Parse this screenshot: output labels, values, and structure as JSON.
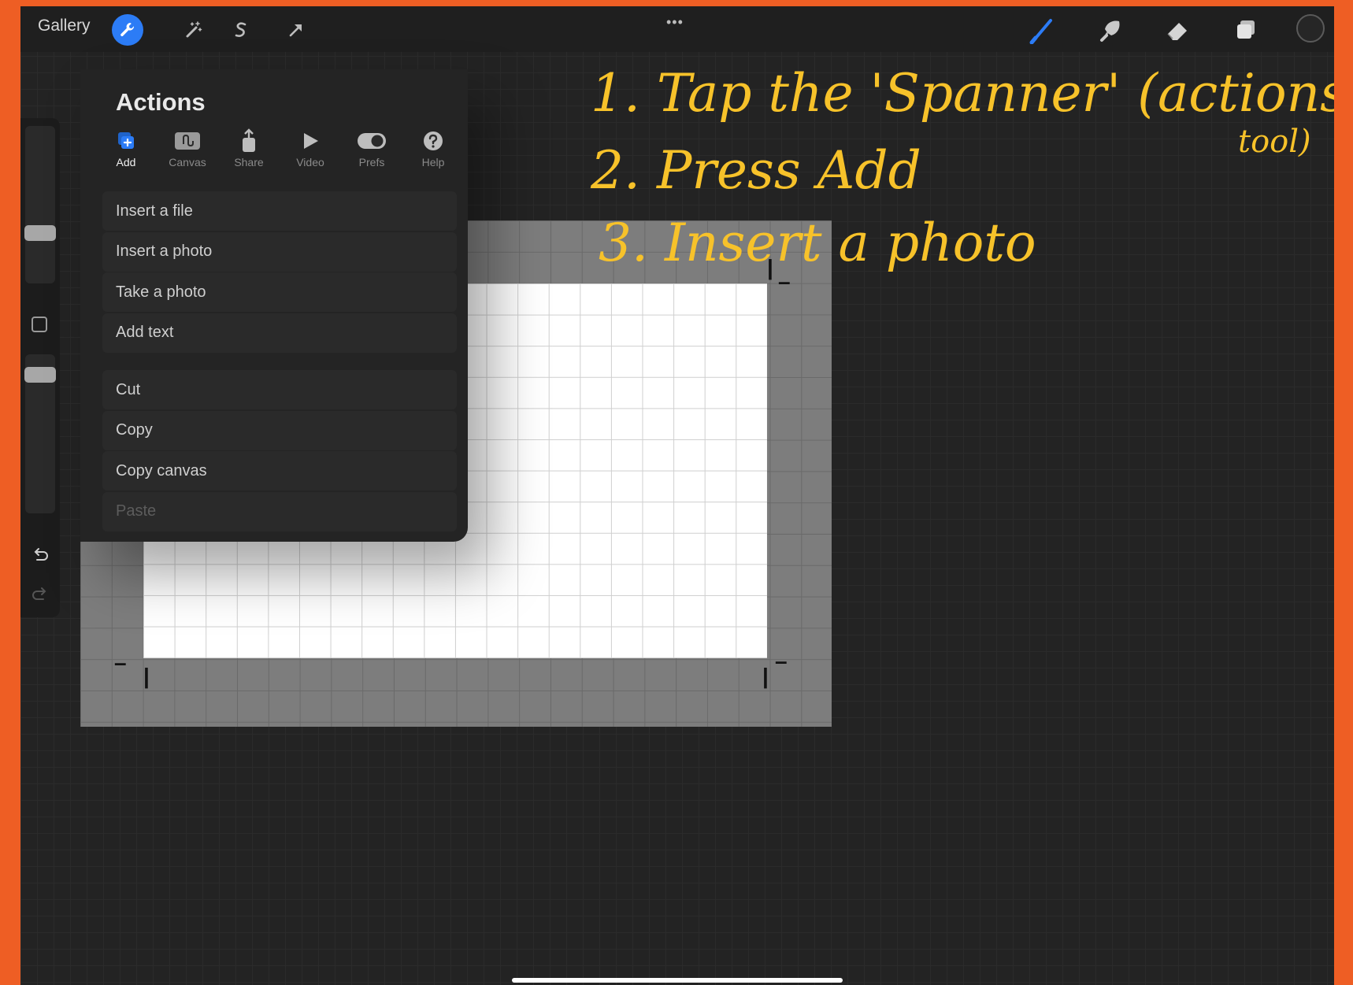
{
  "topbar": {
    "gallery_label": "Gallery",
    "more_dots": "•••",
    "tools_left": [
      "wrench-icon",
      "magic-wand-icon",
      "selection-s-icon",
      "move-arrow-icon"
    ],
    "tools_right": [
      "brush-icon",
      "smudge-icon",
      "eraser-icon",
      "layers-icon",
      "color-icon"
    ],
    "accent_color": "#2c7cf6"
  },
  "sidebar": {
    "icons": [
      "modify-square-icon",
      "undo-icon",
      "redo-icon"
    ]
  },
  "actions_panel": {
    "title": "Actions",
    "tabs": [
      {
        "label": "Add",
        "icon": "add-image-icon",
        "active": true
      },
      {
        "label": "Canvas",
        "icon": "canvas-icon",
        "active": false
      },
      {
        "label": "Share",
        "icon": "share-icon",
        "active": false
      },
      {
        "label": "Video",
        "icon": "play-icon",
        "active": false
      },
      {
        "label": "Prefs",
        "icon": "toggle-icon",
        "active": false
      },
      {
        "label": "Help",
        "icon": "help-icon",
        "active": false
      }
    ],
    "group1": [
      "Insert a file",
      "Insert a photo",
      "Take a photo",
      "Add text"
    ],
    "group2": [
      "Cut",
      "Copy",
      "Copy canvas",
      "Paste"
    ]
  },
  "annotations": {
    "line1": "1. Tap the 'Spanner' (actions",
    "line1_tail": "tool)",
    "line2": "2. Press Add",
    "line3": "3. Insert a photo",
    "color": "#f7c22a"
  }
}
